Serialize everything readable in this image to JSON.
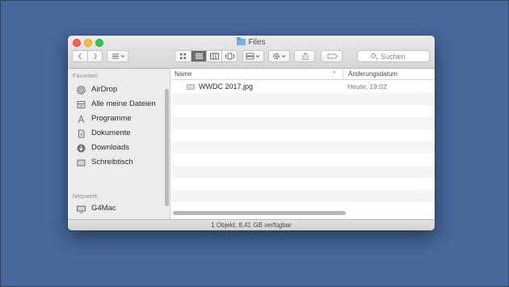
{
  "window": {
    "title": "Files",
    "folder_icon": "folder-icon"
  },
  "toolbar": {
    "back_icon": "chevron-left-icon",
    "forward_icon": "chevron-right-icon",
    "view_options_icon": "list-options-icon",
    "view_modes": [
      "icon-view",
      "list-view",
      "column-view",
      "coverflow-view"
    ],
    "active_view": "list-view",
    "arrange_icon": "arrange-icon",
    "action_icon": "gear-icon",
    "share_icon": "share-icon",
    "tag_icon": "tag-icon",
    "search_placeholder": "Suchen"
  },
  "sidebar": {
    "favorites_heading": "Favoriten",
    "favorites": [
      {
        "label": "AirDrop",
        "icon": "airdrop-icon"
      },
      {
        "label": "Alle meine Dateien",
        "icon": "all-files-icon"
      },
      {
        "label": "Programme",
        "icon": "applications-icon"
      },
      {
        "label": "Dokumente",
        "icon": "documents-icon"
      },
      {
        "label": "Downloads",
        "icon": "downloads-icon"
      },
      {
        "label": "Schreibtisch",
        "icon": "desktop-icon"
      }
    ],
    "network_heading": "Netzwerk",
    "network": [
      {
        "label": "G4Mac",
        "icon": "computer-icon"
      }
    ]
  },
  "columns": {
    "name": "Name",
    "date": "Änderungsdatum"
  },
  "files": [
    {
      "name": "WWDC 2017.jpg",
      "date": "Heute, 19:02",
      "icon": "image-file-icon"
    }
  ],
  "status": {
    "text": "1 Objekt, 8,41 GB verfügbar"
  },
  "colors": {
    "desktop": "#46689a",
    "close": "#fc605c",
    "minimize": "#fdbc40",
    "zoom": "#34c84a",
    "folder": "#6fb1e9"
  }
}
